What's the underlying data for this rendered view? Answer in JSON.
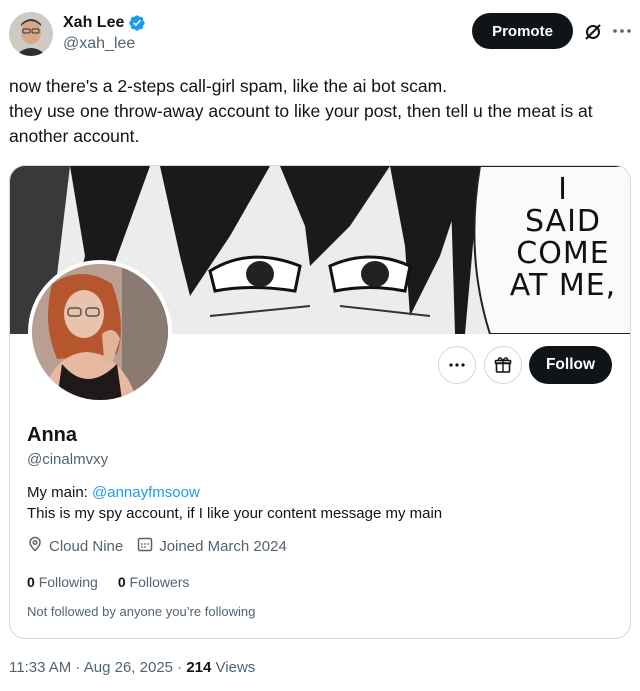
{
  "author": {
    "name": "Xah Lee",
    "handle": "@xah_lee",
    "verified_color": "#1d9bf0"
  },
  "header": {
    "promote_label": "Promote",
    "icons": [
      "grok-slash-icon",
      "more-icon"
    ]
  },
  "tweet": {
    "text": "now there's a 2-steps call-girl spam, like the ai bot scam.\nthey use one throw-away account to like your post, then tell u the meat is at another account."
  },
  "card": {
    "banner_text": "I\nSAID\nCOME\nAT ME,",
    "profile": {
      "name": "Anna",
      "handle": "@cinalmvxy",
      "bio_prefix": "My main: ",
      "bio_mention": "@annayfmsoow",
      "bio_line2": "This is my spy account, if I like your content message my main",
      "location": "Cloud Nine",
      "joined": "Joined March 2024",
      "following_count": "0",
      "following_label": "Following",
      "followers_count": "0",
      "followers_label": "Followers",
      "note": "Not followed by anyone you’re following"
    },
    "follow_label": "Follow"
  },
  "footer": {
    "time": "11:33 AM · Aug 26, 2025 · ",
    "views_count": "214",
    "views_label": " Views"
  }
}
